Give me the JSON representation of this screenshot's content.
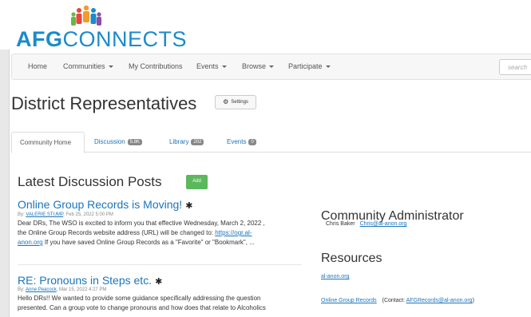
{
  "logo": {
    "afg": "AFG",
    "connects": "CONNECTS",
    "icon": "people-group-icon"
  },
  "nav": {
    "items": [
      {
        "label": "Home",
        "dropdown": false
      },
      {
        "label": "Communities",
        "dropdown": true
      },
      {
        "label": "My Contributions",
        "dropdown": false
      },
      {
        "label": "Events",
        "dropdown": true
      },
      {
        "label": "Browse",
        "dropdown": true
      },
      {
        "label": "Participate",
        "dropdown": true
      }
    ],
    "search_placeholder": "search"
  },
  "page": {
    "title": "District Representatives",
    "settings_label": "Settings",
    "settings_icon": "gear-icon"
  },
  "tabs": [
    {
      "label": "Community Home",
      "badge": "",
      "active": true
    },
    {
      "label": "Discussion",
      "badge": "5.8K",
      "active": false
    },
    {
      "label": "Library",
      "badge": "202",
      "active": false
    },
    {
      "label": "Events",
      "badge": "0",
      "active": false
    }
  ],
  "latest": {
    "heading": "Latest Discussion Posts",
    "add_label": "Add",
    "posts": [
      {
        "title": "Online Group Records is Moving!",
        "by": "By:",
        "author": "VALERIE STUMP",
        "date": ", Feb 25, 2022 5:00 PM",
        "line1": "Dear DRs, The WSO is excited to inform you that effective Wednesday, March 2, 2022 ,",
        "line2_text": "the Online Group Records website address (URL) will be changed to: ",
        "line2_link": "https://ogr.al-",
        "line3_link": "anon.org",
        "line3_text": " If you have saved Online Group Records as a \"Favorite\" or \"Bookmark\", ..."
      },
      {
        "title": "RE: Pronouns in Steps etc.",
        "by": "By:",
        "author": "Anne Peacock",
        "date": ", Mar 15, 2022 4:27 PM",
        "line1": "Hello DRs!! We wanted to provide some guidance specifically addressing the question",
        "line2": "presented. Can a group vote to change pronouns and how does that relate to Alcoholics"
      }
    ],
    "pin_icon": "pin-icon"
  },
  "admin": {
    "heading": "Community Administrator",
    "name": "Chris Baker",
    "email": "Chris@al-anon.org"
  },
  "resources": {
    "heading": "Resources",
    "link1": "al-anon.org",
    "link2": "Online Group Records",
    "contact_prefix": "(Contact: ",
    "contact_email": "AFGRecords@al-anon.org",
    "contact_suffix": ")"
  },
  "colors": {
    "brand_blue": "#1b8bc9",
    "link_blue": "#1b75bb",
    "add_green": "#5cb85c",
    "badge_gray": "#888888"
  }
}
